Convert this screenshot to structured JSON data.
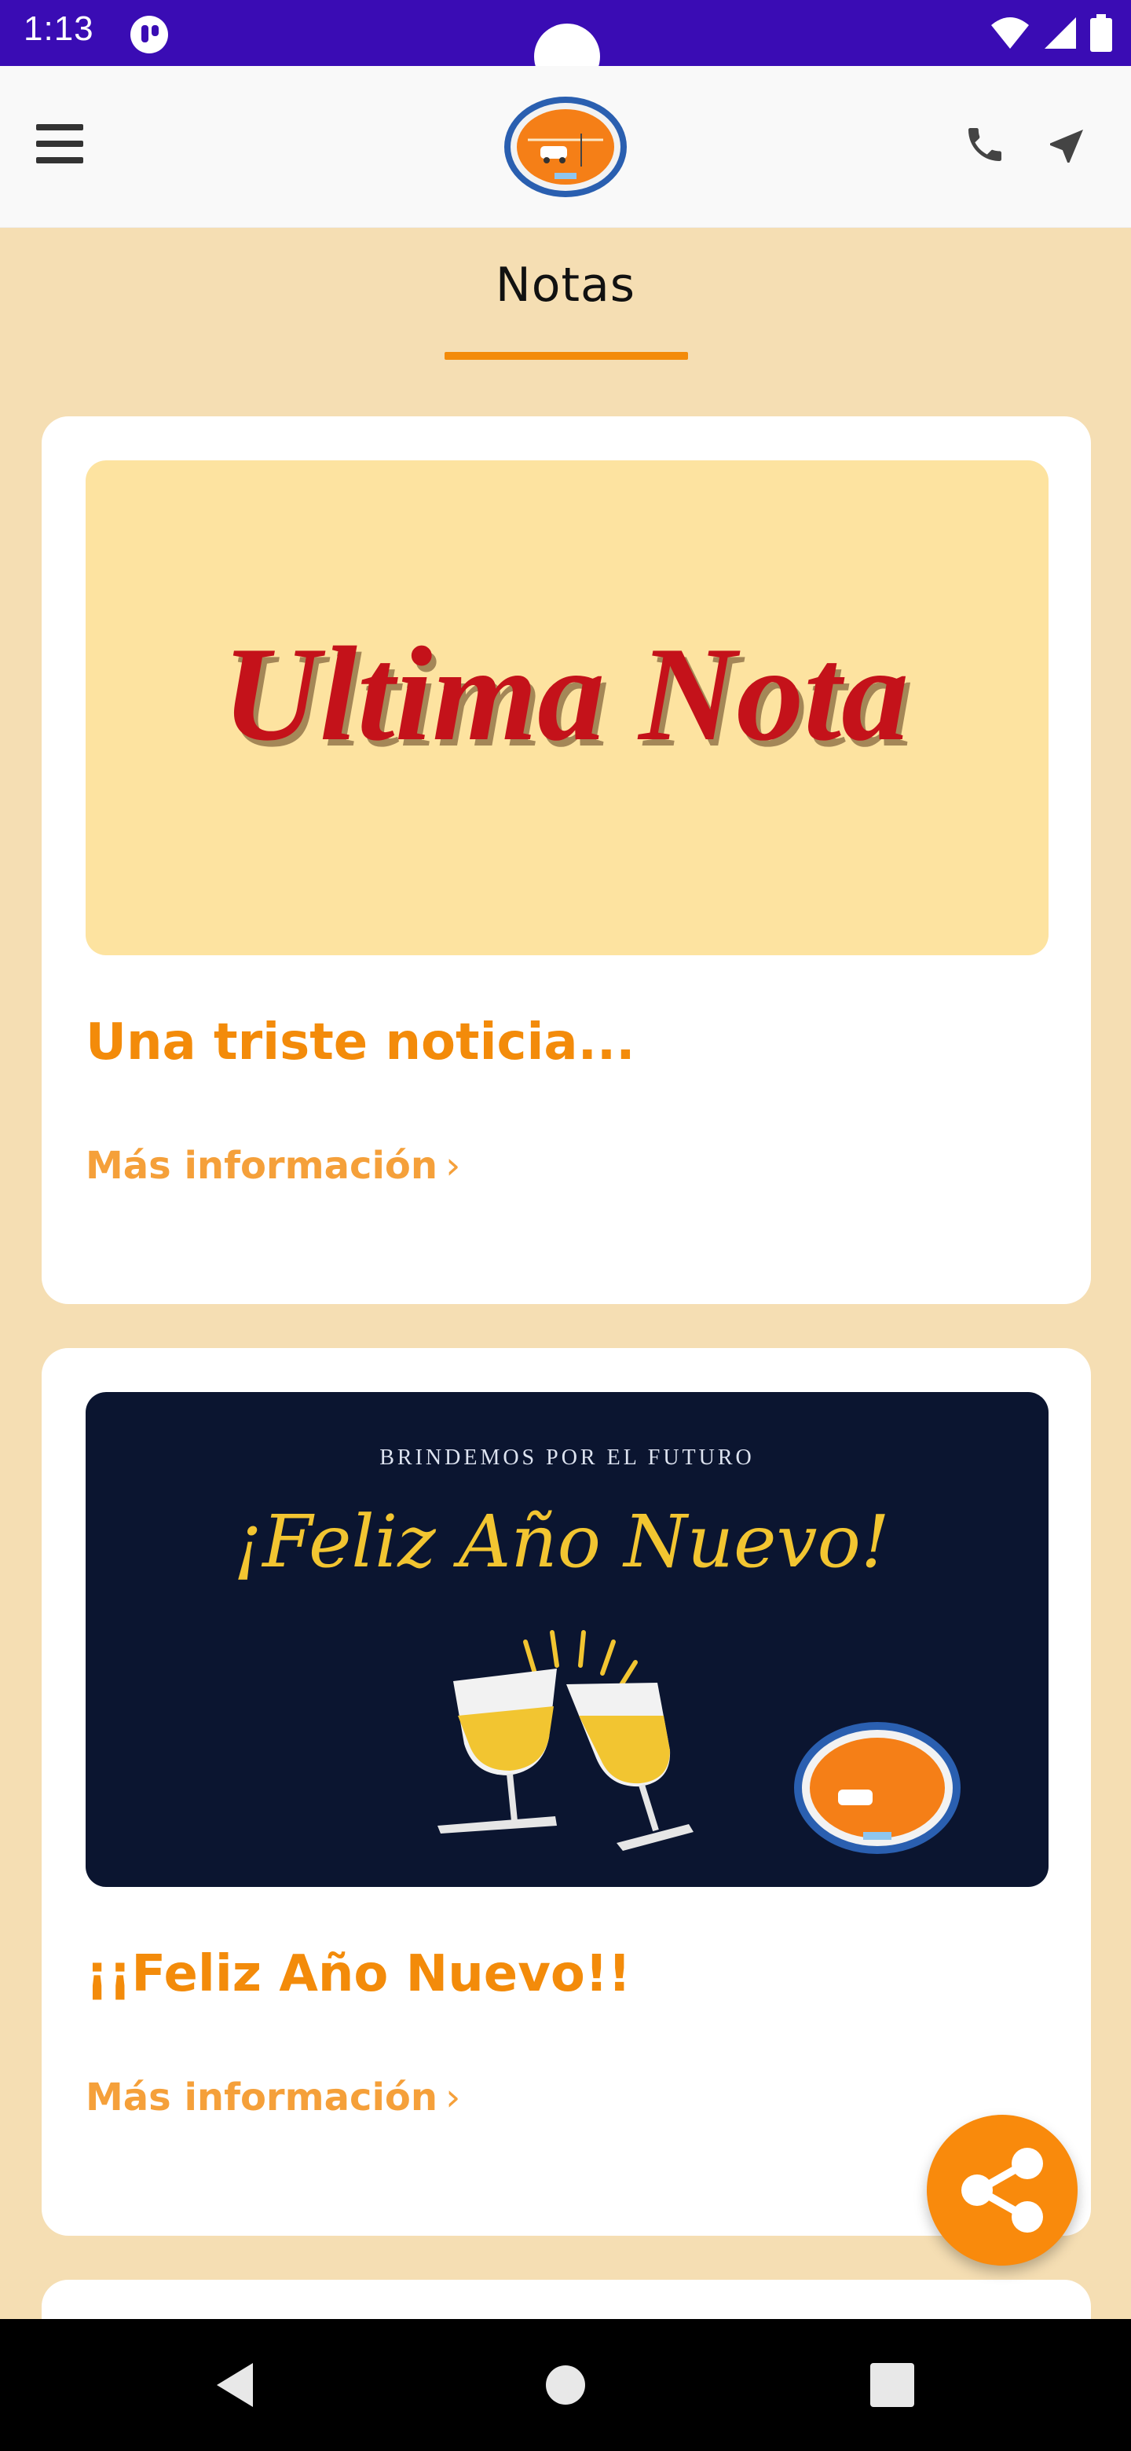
{
  "status_bar": {
    "time": "1:13"
  },
  "page": {
    "title": "Notas"
  },
  "cards": [
    {
      "image_text": "Ultima Nota",
      "title": "Una triste noticia...",
      "link": "Más información"
    },
    {
      "image_kicker": "BRINDEMOS POR EL FUTURO",
      "image_text": "¡Feliz Año Nuevo!",
      "title": "¡¡Feliz Año Nuevo!!",
      "link": "Más información"
    }
  ],
  "colors": {
    "status_bar": "#3a0cb4",
    "accent": "#f38b0a",
    "background": "#f5deb3",
    "fab": "#f98a0c"
  }
}
